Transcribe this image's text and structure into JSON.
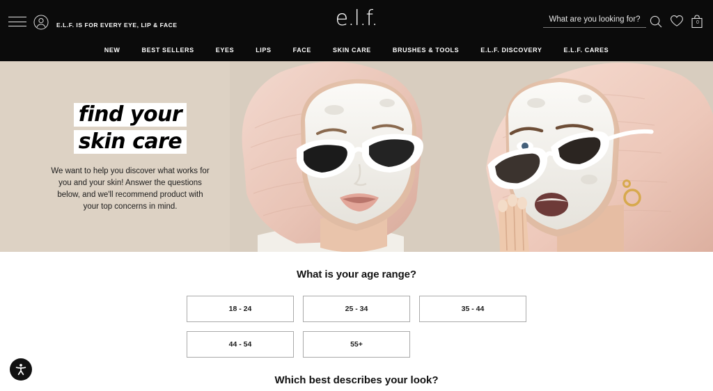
{
  "header": {
    "tagline": "E.L.F. IS FOR EVERY EYE, LIP & FACE",
    "logo": "e.l.f.",
    "menu_icon": "hamburger-icon",
    "account_icon": "account-icon",
    "search": {
      "placeholder": "What are you looking for?",
      "value": "",
      "icon": "search-icon"
    },
    "wishlist_icon": "heart-icon",
    "bag": {
      "icon": "bag-icon",
      "count": "0"
    },
    "nav": [
      {
        "label": "NEW"
      },
      {
        "label": "BEST SELLERS"
      },
      {
        "label": "EYES"
      },
      {
        "label": "LIPS"
      },
      {
        "label": "FACE"
      },
      {
        "label": "SKIN CARE"
      },
      {
        "label": "BRUSHES & TOOLS"
      },
      {
        "label": "E.L.F. DISCOVERY"
      },
      {
        "label": "E.L.F. CARES"
      }
    ]
  },
  "hero": {
    "headline_line1": "find your",
    "headline_line2": "skin care",
    "subtext": "We want to help you discover what works for you and your skin! Answer the questions below, and we'll recommend product with your top concerns in mind.",
    "background_color": "#ddd2c4",
    "image_alt": "two women wearing pink towel turbans, white clay face masks and white cat-eye sunglasses"
  },
  "quiz": {
    "question1": {
      "title": "What is your age range?",
      "options": [
        {
          "label": "18 - 24"
        },
        {
          "label": "25 - 34"
        },
        {
          "label": "35 - 44"
        },
        {
          "label": "44 - 54"
        },
        {
          "label": "55+"
        }
      ]
    },
    "question2": {
      "title": "Which best describes your look?"
    }
  },
  "accessibility": {
    "icon": "accessibility-icon",
    "label": "Accessibility"
  },
  "colors": {
    "header_bg": "#0b0b0b",
    "hero_bg": "#ddd2c4",
    "page_bg": "#ffffff",
    "option_border": "#a9a9a9",
    "text_dark": "#111111"
  }
}
